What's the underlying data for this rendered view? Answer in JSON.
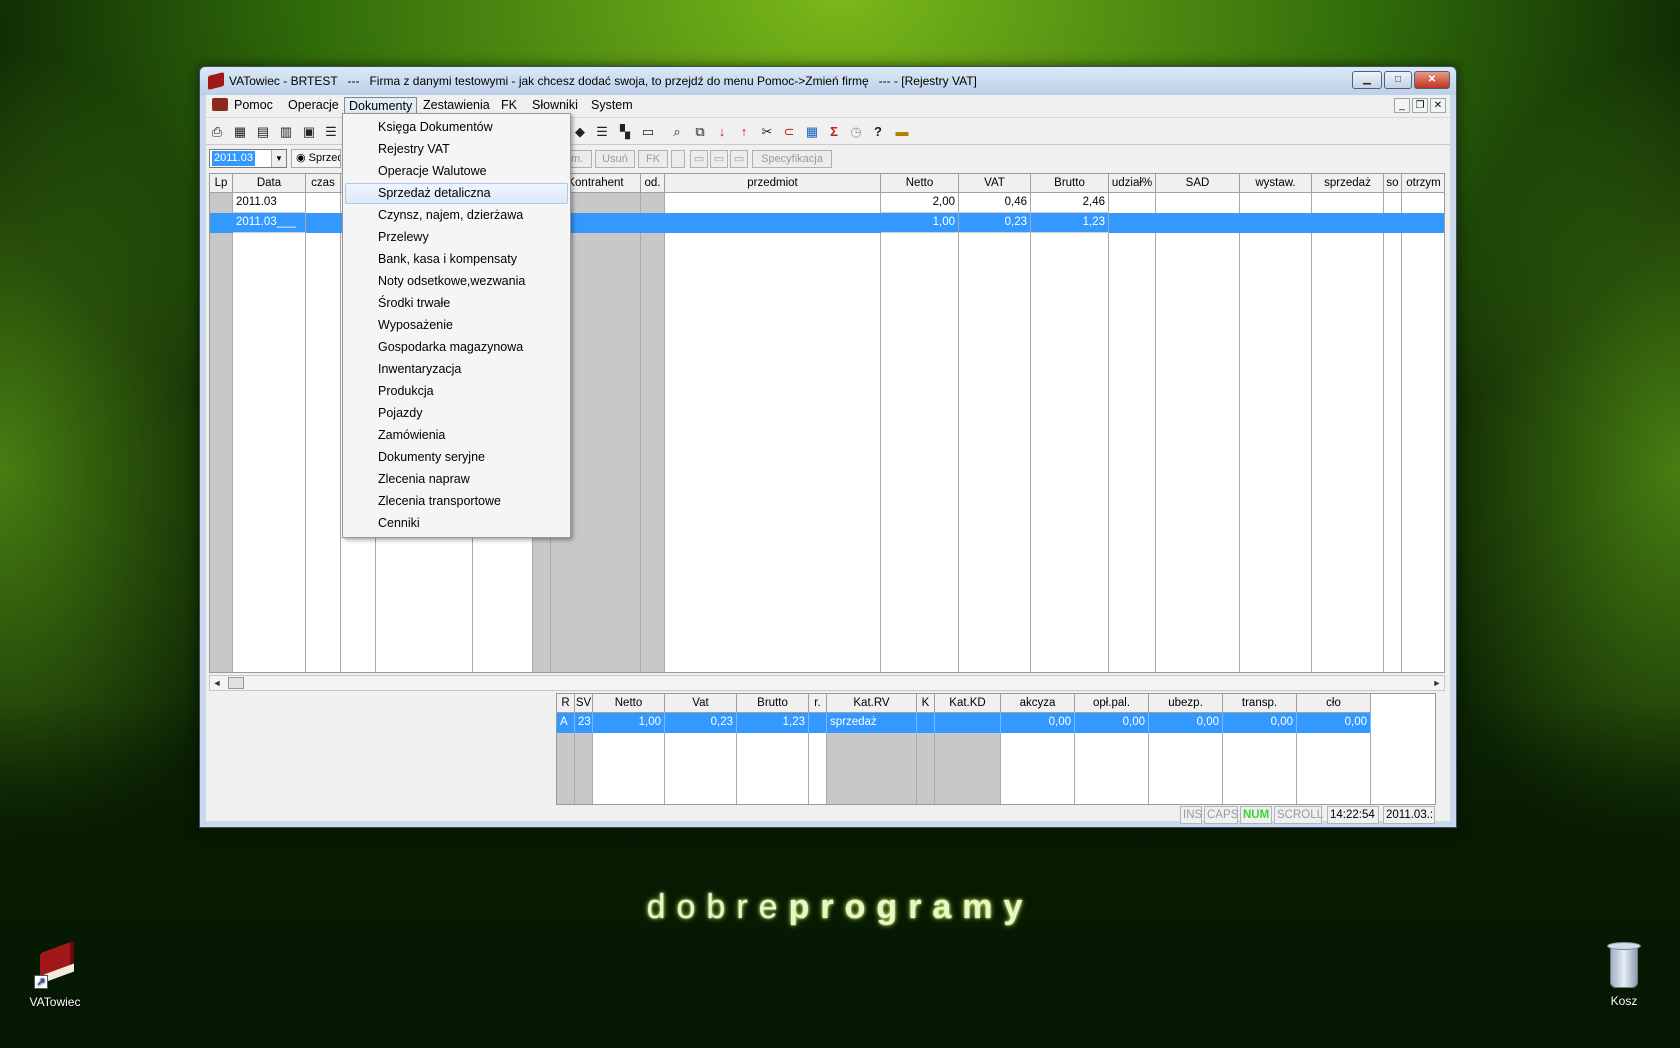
{
  "window": {
    "title": "VATowiec - BRTEST   ---   Firma z danymi testowymi - jak chcesz dodać swoja, to przejdź do menu Pomoc->Zmień firmę   --- - [Rejestry VAT]",
    "min_glyph": "▁",
    "max_glyph": "□",
    "close_glyph": "✕"
  },
  "menubar": {
    "items": [
      "Pomoc",
      "Operacje",
      "Dokumenty",
      "Zestawienia",
      "FK",
      "Słowniki",
      "System"
    ],
    "active": "Dokumenty",
    "mdi_min": "_",
    "mdi_restore": "❐",
    "mdi_close": "✕"
  },
  "toolbar": {
    "icons": [
      "printer-icon",
      "calendar-icon",
      "calculator-icon",
      "bar-chart-icon",
      "calculator2-icon",
      "list-icon",
      "palette-icon",
      "document-icon",
      "grid-icon",
      "eraser-icon",
      "search-icon",
      "copy-icon",
      "sort-asc-icon",
      "sort-desc-icon",
      "cut-icon",
      "link-icon",
      "table-icon",
      "sigma-icon",
      "clock-icon",
      "help-icon",
      "card-icon"
    ]
  },
  "filter": {
    "period": "2011.03",
    "radio_label": "Sprzed",
    "buttons": [
      "am.",
      "Usuń",
      "FK",
      "Specyfikacja"
    ],
    "dropdown_arrow": "▼"
  },
  "grid": {
    "columns": [
      "Lp",
      "Data",
      "czas",
      "",
      "",
      "",
      "",
      "Kontrahent",
      "od.",
      "przedmiot",
      "Netto",
      "VAT",
      "Brutto",
      "udział%",
      "SAD",
      "wystaw.",
      "sprzedaż",
      "so",
      "otrzym"
    ],
    "rows": [
      {
        "data": "2011.03",
        "netto": "2,00",
        "vat": "0,46",
        "brutto": "2,46"
      },
      {
        "data": "2011.03___",
        "netto": "1,00",
        "vat": "0,23",
        "brutto": "1,23"
      }
    ],
    "selected_row": 1,
    "scroll_left": "◄",
    "scroll_right": "►"
  },
  "subgrid": {
    "columns": [
      "R",
      "SV",
      "Netto",
      "Vat",
      "Brutto",
      "r.",
      "Kat.RV",
      "K",
      "Kat.KD",
      "akcyza",
      "opł.pal.",
      "ubezp.",
      "transp.",
      "cło"
    ],
    "row": {
      "r": "A",
      "sv": "23",
      "netto": "1,00",
      "vat": "0,23",
      "brutto": "1,23",
      "r2": "",
      "kat_rv": "sprzedaż",
      "k": "",
      "kat_kd": "",
      "akcyza": "0,00",
      "opl_pal": "0,00",
      "ubezp": "0,00",
      "transp": "0,00",
      "clo": "0,00"
    }
  },
  "statusbar": {
    "ins": "INS",
    "caps": "CAPS",
    "num": "NUM",
    "scroll": "SCROLL",
    "time": "14:22:54",
    "date": "2011.03.:"
  },
  "dropdown": {
    "items": [
      "Księga Dokumentów",
      "Rejestry VAT",
      "Operacje Walutowe",
      "Sprzedaż detaliczna",
      "Czynsz, najem, dzierżawa",
      "Przelewy",
      "Bank, kasa i kompensaty",
      "Noty odsetkowe,wezwania",
      "Środki trwałe",
      "Wyposażenie",
      "Gospodarka magazynowa",
      "Inwentaryzacja",
      "Produkcja",
      "Pojazdy",
      "Zamówienia",
      "Dokumenty seryjne",
      "Zlecenia napraw",
      "Zlecenia transportowe",
      "Cenniki"
    ],
    "highlighted": "Sprzedaż detaliczna"
  },
  "desktop": {
    "brand_light": "dobre",
    "brand_bold": "programy",
    "icons": [
      {
        "label": "VATowiec",
        "icon": "book-shortcut-icon"
      },
      {
        "label": "Kosz",
        "icon": "recycle-bin-icon"
      }
    ]
  }
}
